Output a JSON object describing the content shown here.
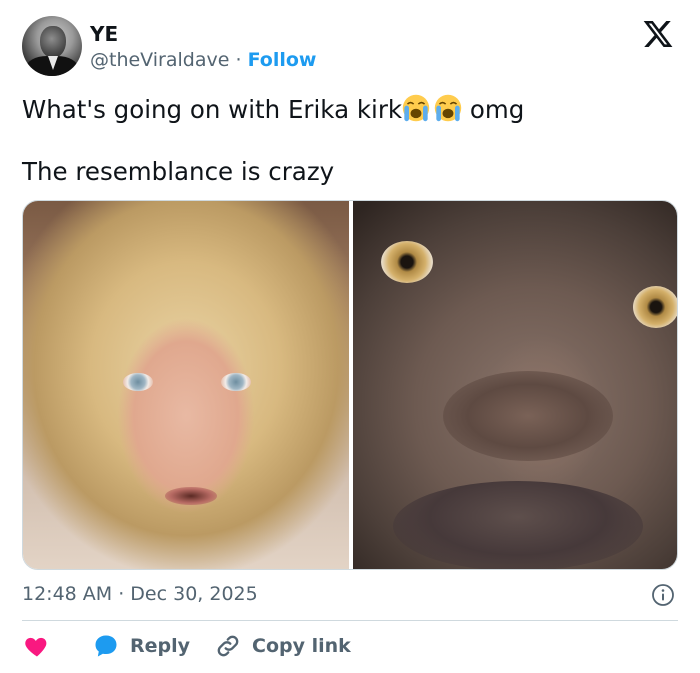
{
  "author": {
    "display_name": "YE",
    "handle": "@theViraldave",
    "separator": "·",
    "follow_label": "Follow"
  },
  "platform_logo": "x-logo",
  "tweet": {
    "line1_before": "What's going on with Erika kirk",
    "line1_emoji": [
      "loudly-crying-face",
      "loudly-crying-face"
    ],
    "line1_after": " omg",
    "line2": "The resemblance is crazy"
  },
  "media": {
    "images": [
      "woman-face-photo",
      "man-face-photo"
    ]
  },
  "meta": {
    "timestamp": "12:48 AM · Dec 30, 2025"
  },
  "actions": {
    "like_label": "",
    "reply_label": "Reply",
    "copy_label": "Copy link"
  },
  "colors": {
    "accent": "#1d9bf0",
    "like": "#f91880",
    "muted": "#536471",
    "text": "#0f1419",
    "border": "#cfd9de"
  }
}
